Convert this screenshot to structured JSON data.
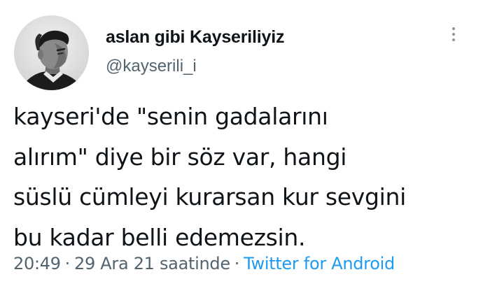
{
  "tweet": {
    "author": {
      "display_name": "aslan gibi Kayseriliyiz",
      "handle": "@kayserili_i",
      "avatar_icon": "profile-photo"
    },
    "text_lines": [
      "kayseri'de \"senin gadalarını",
      "alırım\" diye bir söz var, hangi",
      "süslü cümleyi kurarsan kur sevgini",
      "bu kadar belli edemezsin."
    ],
    "meta": {
      "time": "20:49",
      "separator": "·",
      "date": "29 Ara 21 saatinde",
      "source": "Twitter for Android"
    },
    "more_icon": "more-vertical-icon"
  },
  "colors": {
    "primary_text": "#0f1419",
    "secondary_text": "#536471",
    "link": "#1d9bf0",
    "background": "#ffffff"
  }
}
